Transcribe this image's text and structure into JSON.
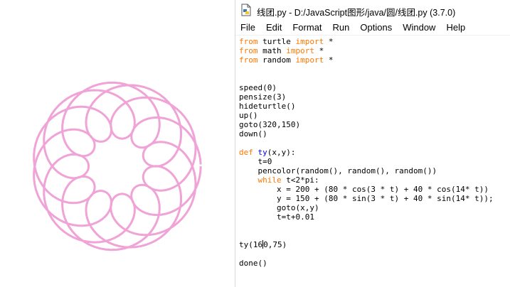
{
  "window": {
    "title": "线团.py - D:/JavaScript图形/java/圆/线团.py (3.7.0)"
  },
  "menu": [
    "File",
    "Edit",
    "Format",
    "Run",
    "Options",
    "Window",
    "Help"
  ],
  "code_lines": [
    [
      [
        "kw",
        "from"
      ],
      [
        "t",
        " turtle "
      ],
      [
        "kw",
        "import"
      ],
      [
        "t",
        " *"
      ]
    ],
    [
      [
        "kw",
        "from"
      ],
      [
        "t",
        " math "
      ],
      [
        "kw",
        "import"
      ],
      [
        "t",
        " *"
      ]
    ],
    [
      [
        "kw",
        "from"
      ],
      [
        "t",
        " random "
      ],
      [
        "kw",
        "import"
      ],
      [
        "t",
        " *"
      ]
    ],
    [],
    [],
    [
      [
        "t",
        "speed(0)"
      ]
    ],
    [
      [
        "t",
        "pensize(3)"
      ]
    ],
    [
      [
        "t",
        "hideturtle()"
      ]
    ],
    [
      [
        "t",
        "up()"
      ]
    ],
    [
      [
        "t",
        "goto(320,150)"
      ]
    ],
    [
      [
        "t",
        "down()"
      ]
    ],
    [],
    [
      [
        "kw",
        "def"
      ],
      [
        "t",
        " "
      ],
      [
        "df",
        "ty"
      ],
      [
        "t",
        "(x,y):"
      ]
    ],
    [
      [
        "t",
        "    t=0"
      ]
    ],
    [
      [
        "t",
        "    pencolor(random(), random(), random())"
      ]
    ],
    [
      [
        "t",
        "    "
      ],
      [
        "kw",
        "while"
      ],
      [
        "t",
        " t<2*pi:"
      ]
    ],
    [
      [
        "t",
        "        x = 200 + (80 * cos(3 * t) + 40 * cos(14* t))"
      ]
    ],
    [
      [
        "t",
        "        y = 150 + (80 * sin(3 * t) + 40 * sin(14* t));"
      ]
    ],
    [
      [
        "t",
        "        goto(x,y)"
      ]
    ],
    [
      [
        "t",
        "        t=t+0.01"
      ]
    ],
    [],
    [],
    [
      [
        "t",
        "ty(16"
      ],
      [
        "caret",
        ""
      ],
      [
        "t",
        "0,75)"
      ]
    ],
    [],
    [
      [
        "t",
        "done()"
      ]
    ]
  ],
  "drawing": {
    "pen_color": "#f0a3d6",
    "description_equation": "x = cx + 80*cos(3t) + 40*cos(14t); y = cy + 80*sin(3t) + 40*sin(14t)"
  }
}
